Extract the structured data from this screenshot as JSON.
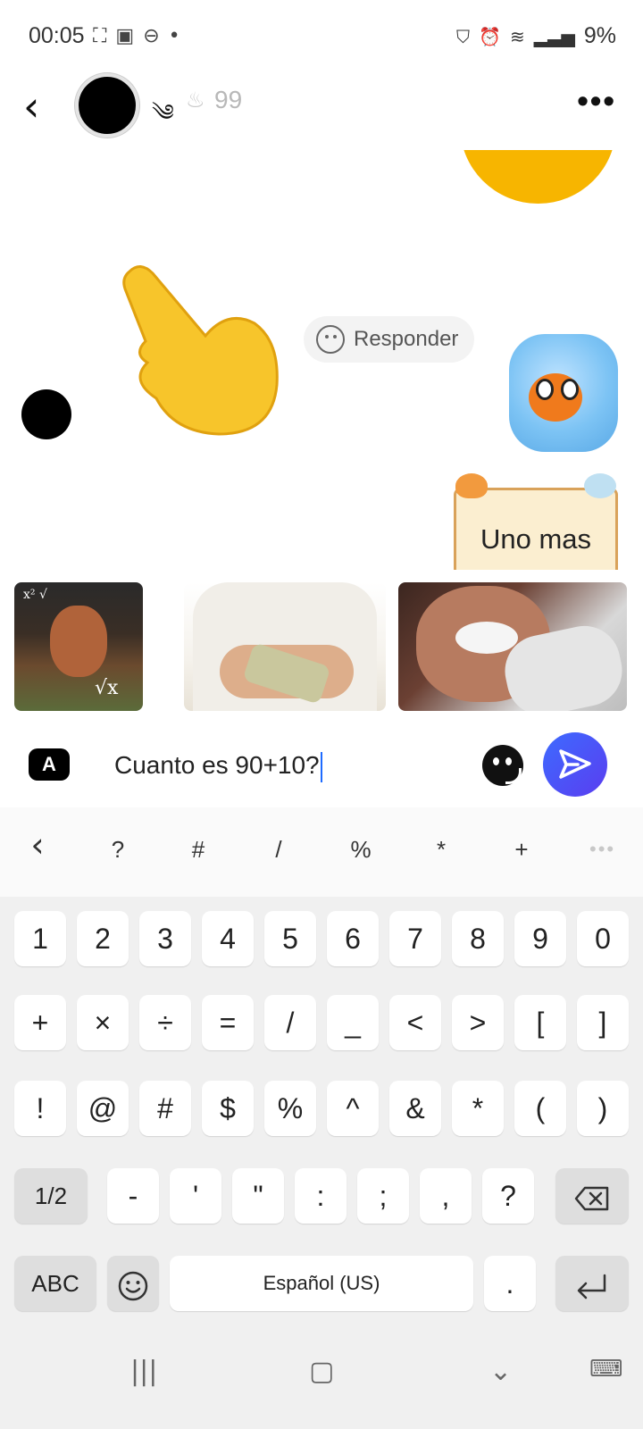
{
  "status_bar": {
    "time": "00:05",
    "left_icons": [
      "screenshot-icon",
      "gallery-icon",
      "do-not-disturb-icon",
      "dot-icon"
    ],
    "right_icons": [
      "vpn-icon",
      "alarm-icon",
      "wifi-icon",
      "signal-icon"
    ],
    "battery": "9%"
  },
  "header": {
    "streak_count": "99",
    "icons": [
      "back-icon",
      "wind-icon",
      "flame-icon",
      "more-icon"
    ]
  },
  "chat": {
    "reply_label": "Responder",
    "sign_text": "Uno mas"
  },
  "input": {
    "format_label": "A",
    "message": "Cuanto es 90+10?"
  },
  "keyboard": {
    "symbol_row": [
      "?",
      "#",
      "/",
      "%",
      "*",
      "+"
    ],
    "row1": [
      "1",
      "2",
      "3",
      "4",
      "5",
      "6",
      "7",
      "8",
      "9",
      "0"
    ],
    "row2": [
      "+",
      "×",
      "÷",
      "=",
      "/",
      "_",
      "<",
      ">",
      "[",
      "]"
    ],
    "row3": [
      "!",
      "@",
      "#",
      "$",
      "%",
      "^",
      "&",
      "*",
      "(",
      ")"
    ],
    "row4": [
      "-",
      "'",
      "\"",
      ":",
      ";",
      ",",
      "?"
    ],
    "page_label": "1/2",
    "abc_label": "ABC",
    "space_label": "Español (US)",
    "period_label": "."
  },
  "colors": {
    "send_button": "#4a5cf5",
    "cursor": "#1e6bff",
    "keyboard_bg": "#f0f0f0"
  }
}
